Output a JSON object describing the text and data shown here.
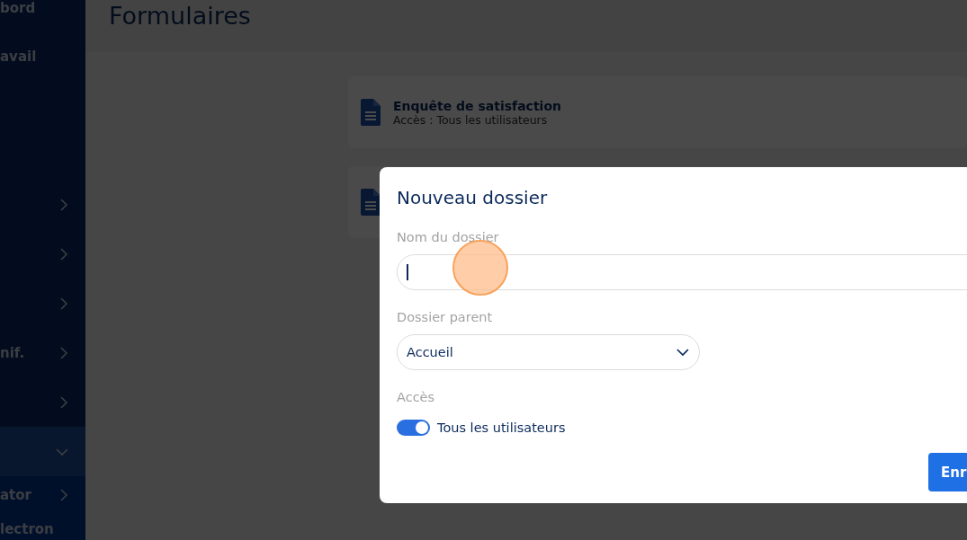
{
  "sidebar": {
    "items": [
      {
        "label": "bord",
        "expandable": false,
        "expanded": false
      },
      {
        "label": "avail",
        "expandable": false,
        "expanded": false
      },
      {
        "expandable": true,
        "expanded": false
      },
      {
        "expandable": true,
        "expanded": false
      },
      {
        "expandable": true,
        "expanded": false
      },
      {
        "label": "nif.",
        "expandable": true,
        "expanded": false
      },
      {
        "expandable": true,
        "expanded": false
      },
      {
        "expandable": true,
        "expanded": true,
        "children": [
          {
            "label": "ator",
            "expandable": true,
            "expanded": false
          },
          {
            "label": "lectron",
            "expandable": false,
            "expanded": false
          }
        ]
      }
    ]
  },
  "page": {
    "title": "Formulaires"
  },
  "forms": [
    {
      "kind": "document",
      "title": "Enquête de satisfaction",
      "access": "Accès : Tous les utilisateurs"
    },
    {
      "kind": "document"
    }
  ],
  "dialog": {
    "title": "Nouveau dossier",
    "name_field": {
      "label": "Nom du dossier"
    },
    "parent_field": {
      "label": "Dossier parent",
      "value": "Accueil"
    },
    "access": {
      "label": "Accès",
      "toggle_label": "Tous les utilisateurs",
      "on": true
    },
    "buttons": [
      "Enr"
    ]
  }
}
